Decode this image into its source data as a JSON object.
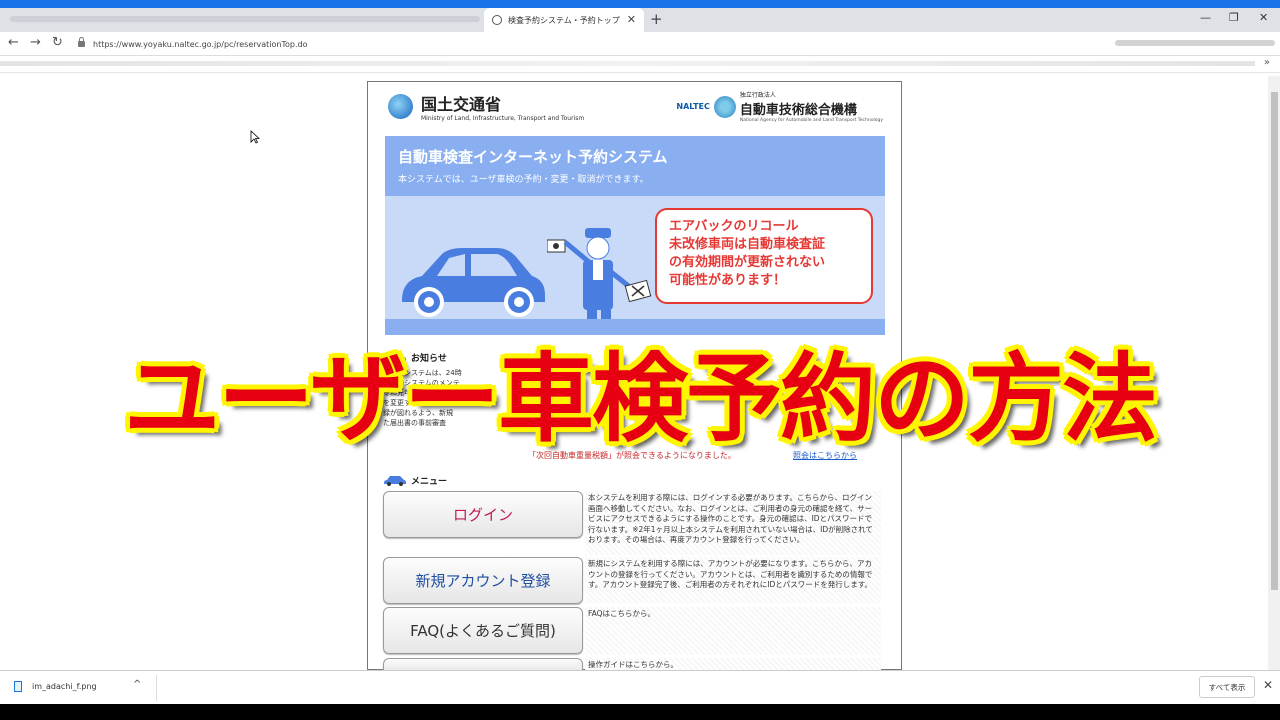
{
  "browser": {
    "tab_title": "検査予約システム・予約トップ",
    "tab_close": "✕",
    "new_tab": "+",
    "minimize": "—",
    "restore": "❐",
    "close": "✕",
    "back": "←",
    "forward": "→",
    "reload": "↻",
    "url": "https://www.yoyaku.naltec.go.jp/pc/reservationTop.do",
    "more": "»"
  },
  "header": {
    "mlit_jp": "国土交通省",
    "mlit_en": "Ministry of Land, Infrastructure, Transport and Tourism",
    "naltec_abbr": "NALTEC",
    "naltec_small": "独立行政法人",
    "naltec_jp": "自動車技術総合機構",
    "naltec_en": "National Agency for Automobile and Land Transport Technology"
  },
  "banner": {
    "title": "自動車検査インターネット予約システム",
    "subtitle": "本システムでは、ユーザ車検の予約・変更・取消ができます。",
    "notice_lines": [
      "エアバックのリコール",
      "未改修車両は自動車検査証",
      "の有効期間が更新されない",
      "可能性があります！"
    ]
  },
  "news": {
    "heading": "お知らせ",
    "lines": [
      "〇予約システムは、24時",
      "〇予約システムのメンテ",
      "令和元年10月1日から",
      "を変更することにより",
      "録が図れるよう、新規",
      "た届出書の事前審査"
    ],
    "red_link": "「次回自動車重量税額」が照会できるようになりました。",
    "link": "照会はこちらから"
  },
  "menu": {
    "heading": "メニュー",
    "items": [
      {
        "label": "ログイン",
        "desc": "本システムを利用する際には、ログインする必要があります。こちらから、ログイン画面へ移動してください。なお、ログインとは、ご利用者の身元の確認を経て、サービスにアクセスできるようにする操作のことです。身元の確認は、IDとパスワードで行ないます。※2年1ヶ月以上本システムを利用されていない場合は、IDが削除されております。その場合は、再度アカウント登録を行ってください。"
      },
      {
        "label": "新規アカウント登録",
        "desc": "新規にシステムを利用する際には、アカウントが必要になります。こちらから、アカウントの登録を行ってください。アカウントとは、ご利用者を識別するための情報です。アカウント登録完了後、ご利用者の方それぞれにIDとパスワードを発行します。"
      },
      {
        "label": "FAQ(よくあるご質問)",
        "desc": "FAQはこちらから。"
      },
      {
        "label": "",
        "desc": "操作ガイドはこちらから。"
      }
    ]
  },
  "overlay_title": "ユーザー車検予約の方法",
  "downloads": {
    "file": "im_adachi_f.png",
    "chevron": "^",
    "show_all": "すべて表示",
    "close": "✕"
  },
  "colors": {
    "accent": "#1a73e8",
    "banner": "#89aff0",
    "notice_red": "#e53935",
    "overlay_red": "#e60012",
    "overlay_outline": "#fff500"
  }
}
